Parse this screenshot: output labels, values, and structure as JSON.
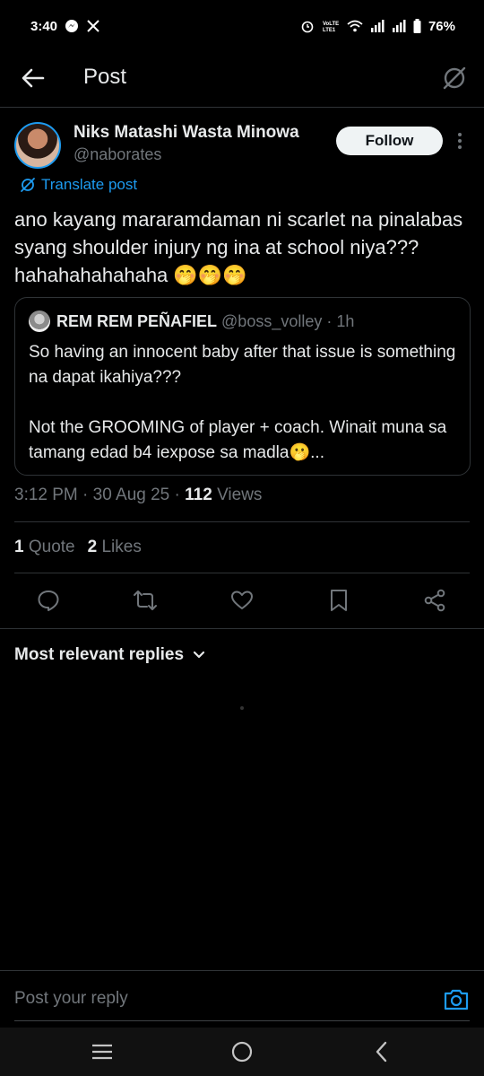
{
  "status_bar": {
    "time": "3:40",
    "battery": "76%",
    "icons": [
      "messenger-icon",
      "x-icon",
      "alarm-icon",
      "volte-icon",
      "wifi-icon",
      "signal-icon",
      "signal-icon",
      "battery-icon"
    ]
  },
  "header": {
    "title": "Post"
  },
  "post": {
    "author_name": "Niks Matashi Wasta Minowa",
    "author_handle": "@naborates",
    "follow_label": "Follow",
    "translate_label": "Translate post",
    "text": "ano kayang mararamdaman ni scarlet na pinalabas syang shoulder injury ng ina at school niya??? hahahahahahaha 🤭🤭🤭",
    "time": "3:12 PM",
    "date": "30 Aug 25",
    "views_count": "112",
    "views_label": "Views",
    "quotes_count": "1",
    "quotes_label": "Quote",
    "likes_count": "2",
    "likes_label": "Likes"
  },
  "quote": {
    "name": "REM REM PEÑAFIEL",
    "handle": "@boss_volley",
    "age": "1h",
    "text": "So having an innocent baby after that issue is something na dapat ikahiya???\n\nNot the GROOMING of player + coach. Winait muna sa tamang edad b4 iexpose sa madla🫢..."
  },
  "replies": {
    "filter_label": "Most relevant replies"
  },
  "reply_bar": {
    "placeholder": "Post your reply"
  },
  "colors": {
    "background": "#000000",
    "text": "#e7e9ea",
    "secondary": "#71767b",
    "accent": "#1d9bf0",
    "border": "#2f3336"
  }
}
